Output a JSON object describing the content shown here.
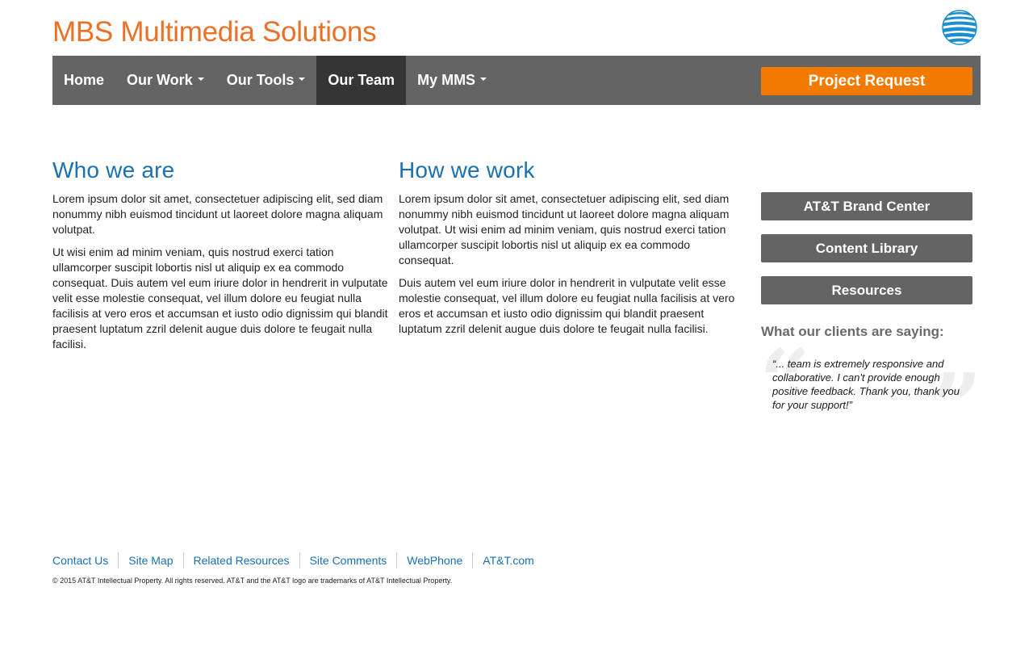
{
  "header": {
    "site_title": "MBS Multimedia Solutions",
    "logo_icon": "att-globe-icon"
  },
  "nav": {
    "items": [
      {
        "label": "Home",
        "has_dropdown": false,
        "active": false
      },
      {
        "label": "Our Work",
        "has_dropdown": true,
        "active": false
      },
      {
        "label": "Our Tools",
        "has_dropdown": true,
        "active": false
      },
      {
        "label": "Our Team",
        "has_dropdown": false,
        "active": true
      },
      {
        "label": "My MMS",
        "has_dropdown": true,
        "active": false
      }
    ],
    "project_request_label": "Project Request"
  },
  "main": {
    "who_we_are": {
      "heading": "Who we are",
      "paragraphs": [
        "Lorem ipsum dolor sit amet, consectetuer adipiscing elit, sed diam nonummy nibh euismod tincidunt ut laoreet dolore magna aliquam volutpat.",
        "Ut wisi enim ad minim veniam, quis nostrud exerci tation ullamcorper suscipit lobortis nisl ut aliquip ex ea commodo consequat. Duis autem vel eum iriure dolor in hendrerit in vulputate velit esse molestie consequat, vel illum dolore eu feugiat nulla facilisis at vero eros et accumsan et iusto odio dignissim qui blandit praesent luptatum zzril delenit augue duis dolore te feugait nulla facilisi."
      ]
    },
    "how_we_work": {
      "heading": "How we work",
      "paragraphs": [
        "Lorem ipsum dolor sit amet, consectetuer adipiscing elit, sed diam nonummy nibh euismod tincidunt ut laoreet dolore magna aliquam volutpat. Ut wisi enim ad minim veniam, quis nostrud exerci tation ullamcorper suscipit lobortis nisl ut aliquip ex ea commodo consequat.",
        "Duis autem vel eum iriure dolor in hendrerit in vulputate velit esse molestie consequat, vel illum dolore eu feugiat nulla facilisis at vero eros et accumsan et iusto odio dignissim qui blandit praesent luptatum zzril delenit augue duis dolore te feugait nulla facilisi."
      ]
    }
  },
  "sidebar": {
    "buttons": [
      "AT&T Brand Center",
      "Content Library",
      "Resources"
    ],
    "clients_heading": "What our clients are saying:",
    "quote": "“... team is extremely responsive and collaborative. I can't provide enough positive feedback. Thank you, thank you for your support!”"
  },
  "footer": {
    "links": [
      "Contact Us",
      "Site Map",
      "Related Resources",
      "Site Comments",
      "WebPhone",
      "AT&T.com"
    ],
    "copyright": "© 2015 AT&T Intellectual Property. All rights reserved. AT&T and the AT&T logo are trademarks of AT&T Intellectual Property."
  },
  "colors": {
    "brand_orange": "#ea7125",
    "button_orange": "#f27a00",
    "nav_gray": "#646464",
    "nav_active": "#353535",
    "link_blue": "#1a70b0",
    "globe_blue": "#1a8fd0"
  }
}
